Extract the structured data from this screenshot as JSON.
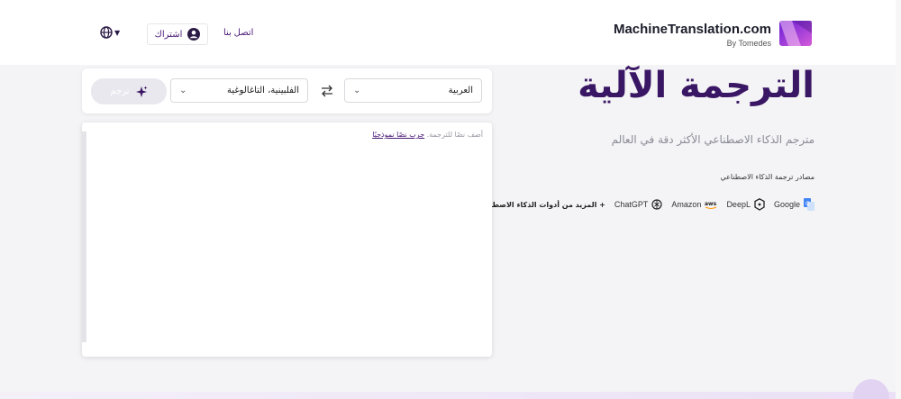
{
  "header": {
    "logo_title": "MachineTranslation.com",
    "logo_sub": "By Tomedes",
    "contact_label": "اتصل بنا",
    "subscribe_label": "اشتراك"
  },
  "hero": {
    "title": "الترجمة الآلية",
    "subtitle": "مترجم الذكاء الاصطناعي الأكثر دقة في العالم",
    "sources_label": "مصادر ترجمة الذكاء الاصطناعي",
    "providers": [
      "Google",
      "DeepL",
      "Amazon",
      "ChatGPT"
    ],
    "more_tools": "+ المزيد من أدوات الذكاء الاصطناعي"
  },
  "translator": {
    "source_lang": "العربية",
    "target_lang": "الفلبينية، التاغالوغية",
    "translate_label": "ترجم",
    "placeholder_text": "أضف نصًا للترجمة.",
    "sample_link": "جرب نصًا نموذجيًا"
  },
  "colors": {
    "brand_purple": "#3a1764",
    "accent_purple": "#4a1a78",
    "logo_gradient_start": "#7b2ff7",
    "logo_gradient_end": "#c24bd8"
  }
}
